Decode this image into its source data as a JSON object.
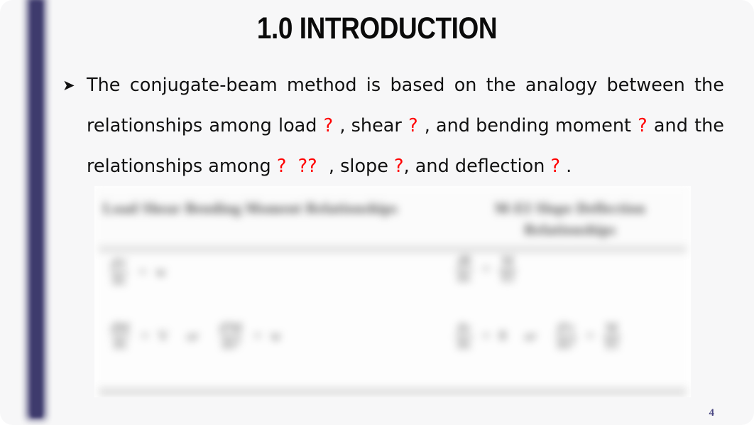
{
  "slide": {
    "title": "1.0 INTRODUCTION",
    "page_number": "4",
    "accent_color": "#454273",
    "background_color": "#f7f7f8",
    "missing_glyph_color": "#ff0000"
  },
  "body": {
    "bullet_marker": "➤",
    "line1": {
      "words": [
        "The",
        "conjugate-beam",
        "method",
        "is",
        "based",
        "on",
        "the",
        "analogy",
        "between",
        "the"
      ]
    },
    "line2": {
      "seg1": "relationships",
      "seg2": "among",
      "seg3": "load",
      "q1": "?",
      "seg4": ", shear",
      "q2": "?",
      "seg5": ", and bending moment",
      "q3": "?",
      "seg6": "and",
      "seg7": "the"
    },
    "line3": {
      "seg1": "relationships among",
      "q1": "?",
      "q2": "??",
      "seg2": ", slope",
      "q3": "?",
      "seg3": ", and deflection",
      "q4": "?",
      "seg4": "."
    },
    "full_text": "The conjugate-beam method is based on the analogy between the relationships among load ? , shear ? , and bending moment ?  and the relationships among ?  ??  , slope ? , and deflection ? ."
  },
  "embedded_table": {
    "caption_left": "Load Shear Bending Moment Relationships",
    "caption_right": "M-EI Slope Deflection Relationships",
    "blurred": true,
    "rows": [
      {
        "left": {
          "num": "dV",
          "den": "dx",
          "op": "=",
          "rhs": "w"
        },
        "right": {
          "num": "dθ",
          "den": "dx",
          "op": "=",
          "rhs_num": "M",
          "rhs_den": "EI"
        }
      },
      {
        "left": {
          "num": "dM",
          "den": "dx",
          "op": "=",
          "rhs": "V",
          "or": "or",
          "alt_num": "d²M",
          "alt_den": "dx²",
          "alt_op": "=",
          "alt_rhs": "w"
        },
        "right": {
          "num": "dv",
          "den": "dx",
          "op": "=",
          "rhs": "θ",
          "or": "or",
          "alt_num": "d²v",
          "alt_den": "dx²",
          "alt_op": "=",
          "alt_rhs_num": "M",
          "alt_rhs_den": "EI"
        }
      }
    ]
  }
}
